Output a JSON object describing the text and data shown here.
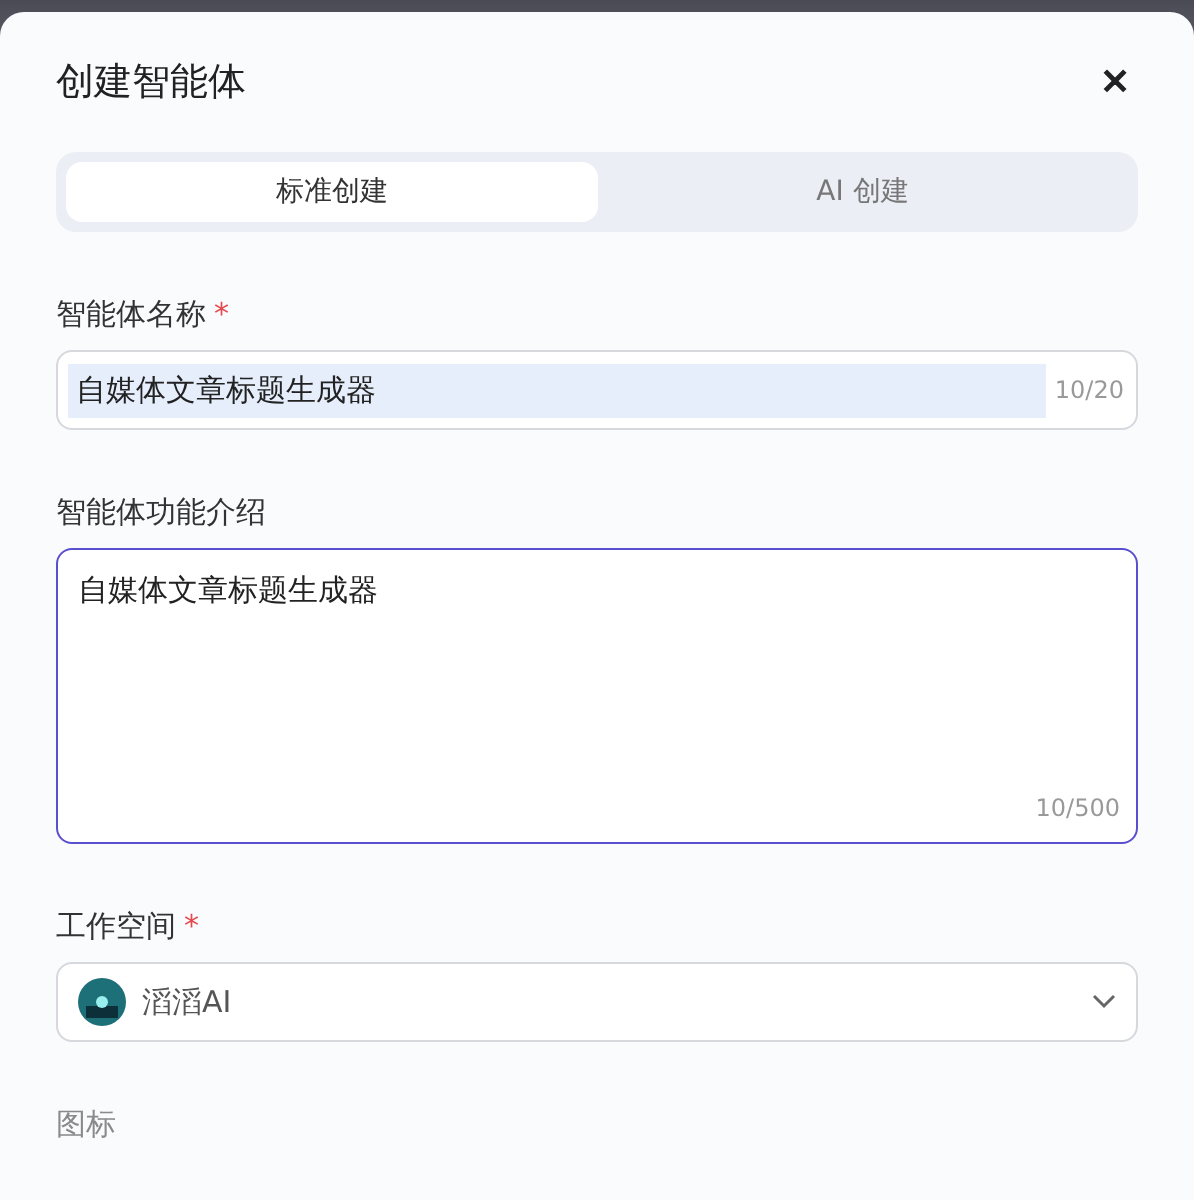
{
  "dialog": {
    "title": "创建智能体",
    "close": "✕",
    "required_mark": "*"
  },
  "tabs": [
    {
      "label": "标准创建",
      "selected": true
    },
    {
      "label": "AI 创建",
      "selected": false
    }
  ],
  "fields": [
    {
      "kind": "input",
      "label": "智能体名称",
      "required": true,
      "value": "自媒体文章标题生成器",
      "selected_text": true,
      "counter": "10/20"
    },
    {
      "kind": "textarea",
      "label": "智能体功能介绍",
      "required": false,
      "value": "自媒体文章标题生成器",
      "focused": true,
      "counter": "10/500"
    },
    {
      "kind": "select",
      "label": "工作空间",
      "required": true,
      "value": "滔滔AI"
    },
    {
      "kind": "faded",
      "label": "图标",
      "required": false
    }
  ]
}
